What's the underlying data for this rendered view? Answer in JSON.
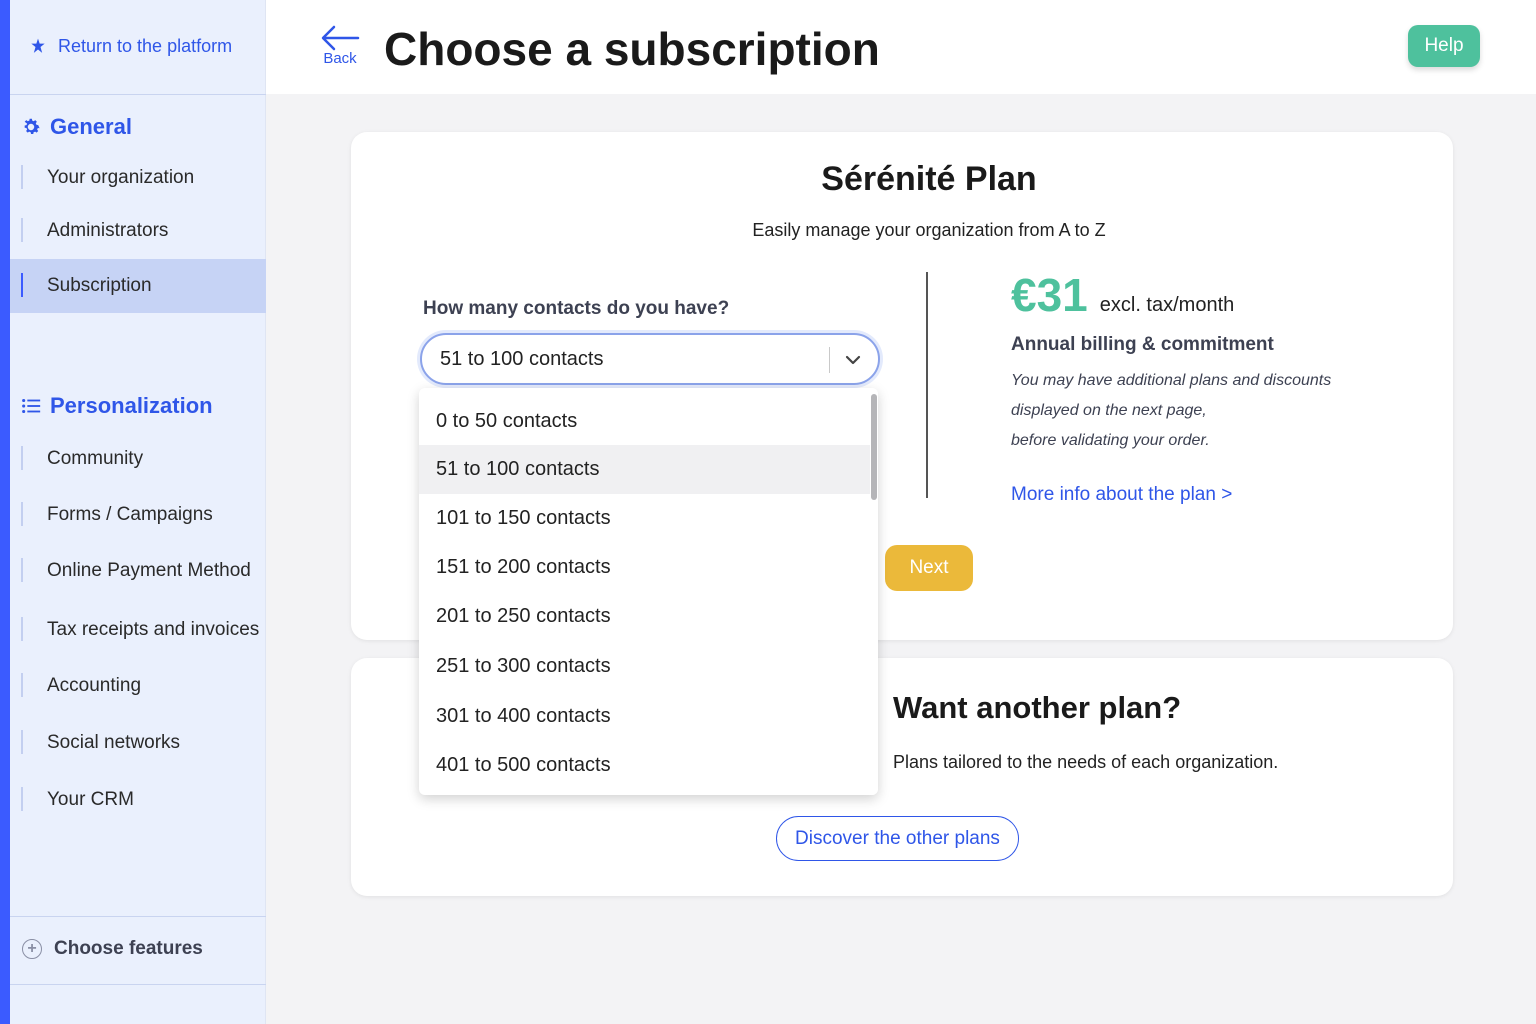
{
  "sidebar": {
    "return_label": "Return to the platform",
    "general_title": "General",
    "general_items": [
      "Your organization",
      "Administrators",
      "Subscription"
    ],
    "personalization_title": "Personalization",
    "personalization_items": [
      "Community",
      "Forms / Campaigns",
      "Online Payment Method",
      "Tax receipts and invoices",
      "Accounting",
      "Social networks",
      "Your CRM"
    ],
    "choose_features": "Choose features",
    "active_item": "Subscription"
  },
  "header": {
    "back_label": "Back",
    "title": "Choose a subscription",
    "help_label": "Help"
  },
  "plan": {
    "name": "Sérénité Plan",
    "subtitle": "Easily manage your organization from A to Z",
    "contacts_label": "How many contacts do you have?",
    "selected_contacts": "51 to 100 contacts",
    "price": "€31",
    "price_unit": "excl. tax/month",
    "billing": "Annual billing & commitment",
    "note_lines": [
      "You may have additional plans and discounts",
      "displayed on the next page,",
      "before validating your order."
    ],
    "more_info": "More info about the plan >",
    "next_label": "Next"
  },
  "other": {
    "title": "Want another plan?",
    "subtitle": "Plans tailored to the needs of each organization.",
    "discover_label": "Discover the other plans"
  },
  "dropdown": {
    "options": [
      "0 to 50 contacts",
      "51 to 100 contacts",
      "101 to 150 contacts",
      "151 to 200 contacts",
      "201 to 250 contacts",
      "251 to 300 contacts",
      "301 to 400 contacts",
      "401 to 500 contacts"
    ],
    "selected_index": 1
  },
  "colors": {
    "accent": "#2f56e8",
    "sidebar_bar": "#3b5bff",
    "price_green": "#4ec19d",
    "help_green": "#4ec19d",
    "next_yellow": "#ebb93a"
  },
  "icons": {
    "return": "pin-icon",
    "general": "gear-icon",
    "personalization": "list-icon",
    "back": "arrow-left-icon",
    "select": "chevron-down-icon",
    "features": "plus-circle-icon"
  }
}
